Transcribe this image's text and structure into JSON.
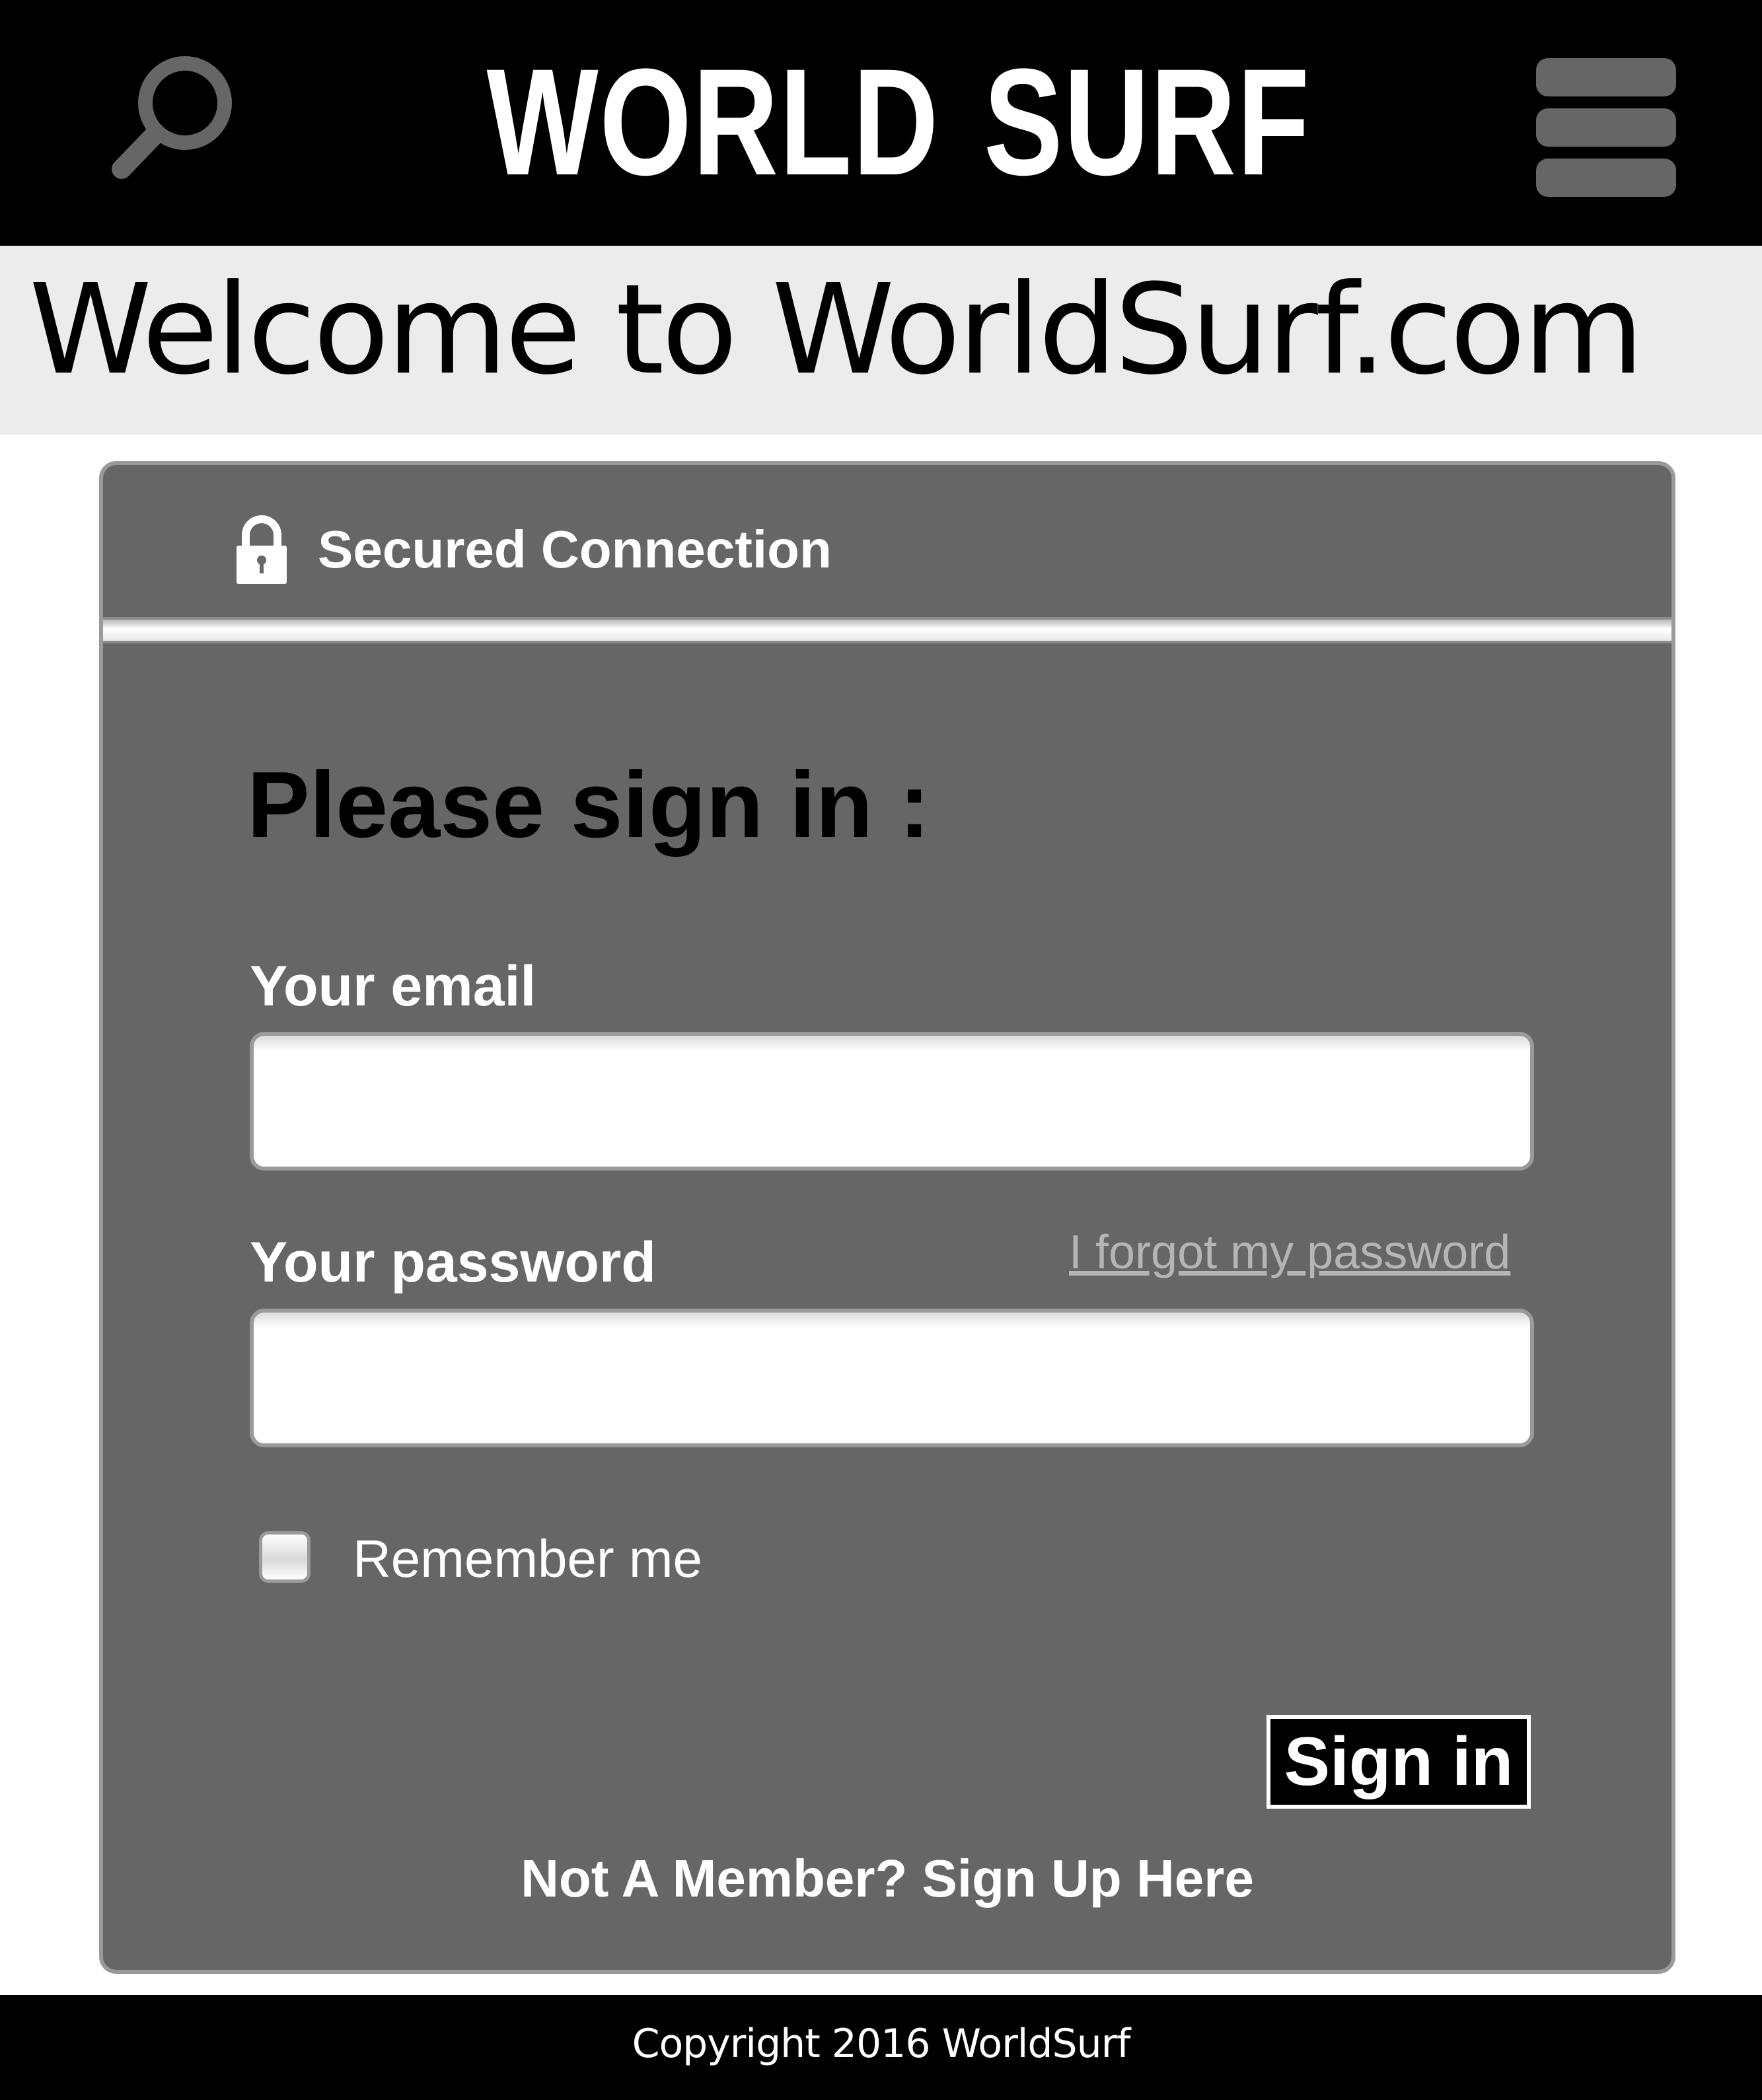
{
  "header": {
    "brand": "WORLD SURF",
    "search_icon": "search-icon",
    "menu_icon": "hamburger-menu-icon"
  },
  "banner": {
    "welcome": "Welcome to WorldSurf.com"
  },
  "login": {
    "secured_label": "Secured Connection",
    "lock_icon": "lock-icon",
    "title": "Please sign in :",
    "email_label": "Your email",
    "email_value": "",
    "password_label": "Your password",
    "password_value": "",
    "forgot_label": "I forgot my password",
    "remember_label": "Remember me",
    "remember_checked": false,
    "signin_label": "Sign in",
    "signup_label": "Not A Member? Sign Up Here"
  },
  "footer": {
    "copyright": "Copyright 2016 WorldSurf"
  },
  "colors": {
    "header_bg": "#000000",
    "banner_bg": "#ececec",
    "card_bg": "#666666",
    "icon_gray": "#666666",
    "link_gray": "#b5b5b5",
    "text_white": "#ffffff"
  }
}
